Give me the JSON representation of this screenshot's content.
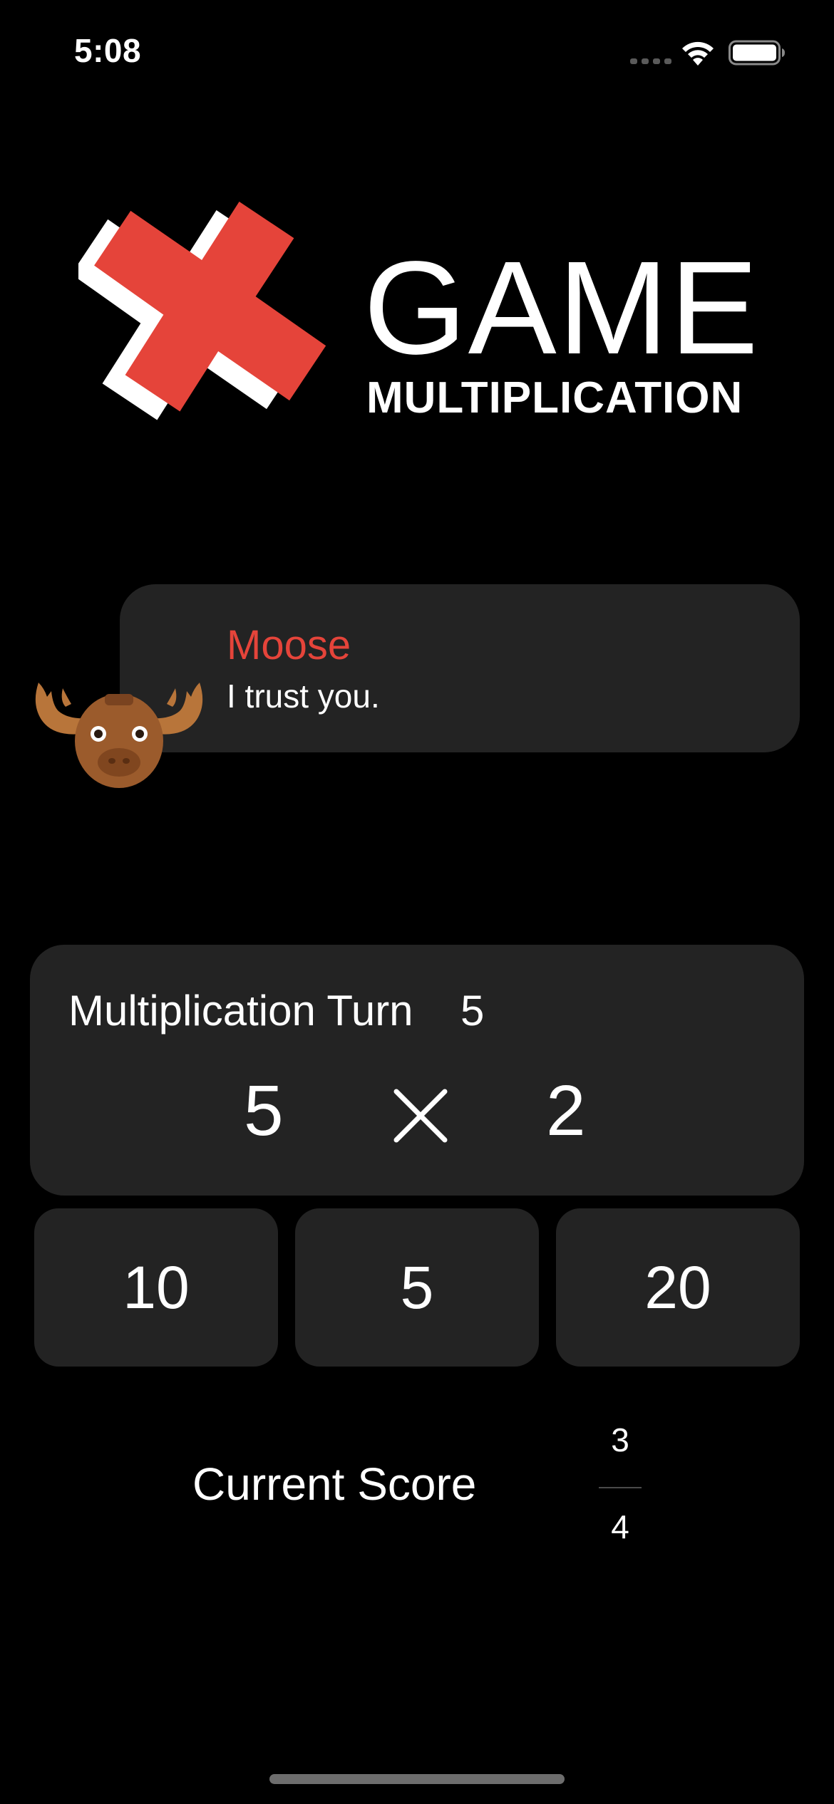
{
  "status_bar": {
    "time": "5:08"
  },
  "logo": {
    "title": "GAME",
    "subtitle": "MULTIPLICATION",
    "icon": "multiplication-cross-icon",
    "accent_color": "#e5443a"
  },
  "speech": {
    "name": "Moose",
    "text": "I trust you.",
    "avatar": "moose-icon",
    "name_color": "#e5443a"
  },
  "question": {
    "label": "Multiplication Turn",
    "turn": "5",
    "operand_a": "5",
    "operator": "times-icon",
    "operand_b": "2"
  },
  "answers": [
    {
      "label": "10"
    },
    {
      "label": "5"
    },
    {
      "label": "20"
    }
  ],
  "score": {
    "label": "Current Score",
    "correct": "3",
    "total": "4"
  },
  "colors": {
    "background": "#000000",
    "card": "#232323",
    "text": "#ffffff",
    "accent": "#e5443a"
  }
}
